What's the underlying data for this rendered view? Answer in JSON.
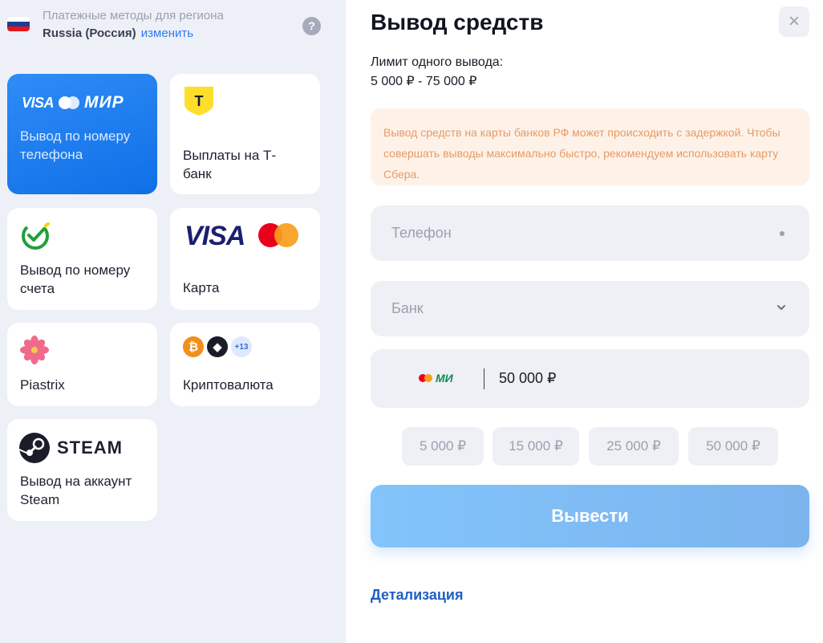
{
  "region": {
    "label": "Платежные методы для региона",
    "country": "Russia (Россия)",
    "change_link": "изменить",
    "help_symbol": "?",
    "flag_colors": [
      "#ffffff",
      "#1c3f94",
      "#e4181c"
    ]
  },
  "methods": [
    {
      "id": "phone",
      "label": "Вывод по номеру телефона",
      "active": true,
      "logo_text": {
        "visa": "VISA",
        "mir": "МИР"
      }
    },
    {
      "id": "tbank",
      "label": "Выплаты на Т-банк",
      "active": false,
      "logo_text": {
        "letter": "Т"
      }
    },
    {
      "id": "account",
      "label": "Вывод по номеру счета",
      "active": false
    },
    {
      "id": "card",
      "label": "Карта",
      "active": false,
      "logo_text": {
        "visa": "VISA"
      }
    },
    {
      "id": "piastrix",
      "label": "Piastrix",
      "active": false
    },
    {
      "id": "crypto",
      "label": "Криптовалюта",
      "active": false,
      "logo_text": {
        "btc": "₿",
        "eth": "◆",
        "more": "+13"
      }
    },
    {
      "id": "steam",
      "label": "Вывод на аккаунт Steam",
      "active": false,
      "logo_text": {
        "word": "STEAM"
      }
    }
  ],
  "withdraw": {
    "title": "Вывод средств",
    "close_symbol": "×",
    "limit_label": "Лимит одного вывода:",
    "limit_range": "5 000 ₽ - 75 000 ₽",
    "notice": "Вывод средств на карты банков РФ может происходить с задержкой. Чтобы совершать выводы максимально быстро, рекомендуем использовать карту Сбера.",
    "phone_placeholder": "Телефон",
    "bank_placeholder": "Банк",
    "amount_logo": "МИ",
    "amount": "50 000 ₽",
    "presets": [
      "5 000 ₽",
      "15 000 ₽",
      "25 000 ₽",
      "50 000 ₽"
    ],
    "submit": "Вывести",
    "details_link": "Детализация"
  },
  "colors": {
    "accent": "#1177ee",
    "link": "#2d7cf0",
    "notice_bg": "#fef2e8",
    "notice_text": "#e69a66",
    "submit_bg": "#82c4fb"
  }
}
